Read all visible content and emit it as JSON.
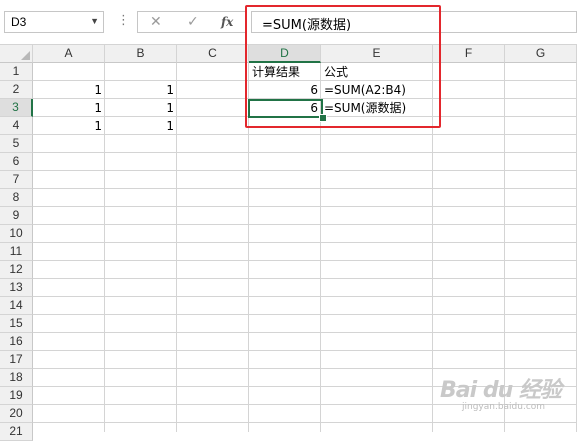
{
  "formula_bar": {
    "name_box": "D3",
    "cancel_glyph": "✕",
    "confirm_glyph": "✓",
    "fx_label": "fx",
    "formula": "=SUM(源数据)"
  },
  "columns": [
    "A",
    "B",
    "C",
    "D",
    "E",
    "F",
    "G"
  ],
  "selected_column": "D",
  "rows": [
    "1",
    "2",
    "3",
    "4",
    "5",
    "6",
    "7",
    "8",
    "9",
    "10",
    "11",
    "12",
    "13",
    "14",
    "15",
    "16",
    "17",
    "18",
    "19",
    "20",
    "21"
  ],
  "selected_row": "3",
  "cells": {
    "A2": "1",
    "B2": "1",
    "A3": "1",
    "B3": "1",
    "A4": "1",
    "B4": "1",
    "D1": "计算结果",
    "E1": "公式",
    "D2": "6",
    "E2": "=SUM(A2:B4)",
    "D3": "6",
    "E3": "=SUM(源数据)"
  },
  "active_cell": "D3",
  "colors": {
    "selection_green": "#217346",
    "annotation_red": "#e3272d",
    "header_bg": "#f0f0f0",
    "gridline": "#d4d4d4"
  },
  "watermark": {
    "logo_text": "Bai du 经验",
    "url_text": "jingyan.baidu.com"
  }
}
